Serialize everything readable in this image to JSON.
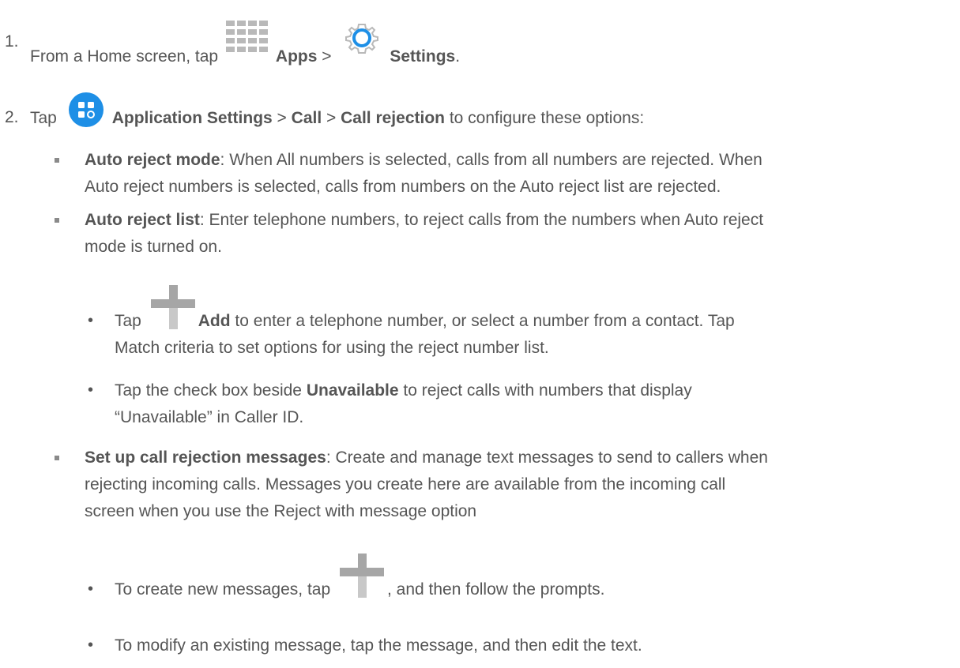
{
  "steps": [
    {
      "number": "1.",
      "pre": "From a Home screen, tap ",
      "apps_label": "Apps",
      "sep": " > ",
      "settings_label": "Settings",
      "end": "."
    },
    {
      "number": "2.",
      "pre": "Tap ",
      "app_settings_label": "Application Settings",
      "sep1": " > ",
      "call_label": "Call",
      "sep2": " > ",
      "call_rejection_label": "Call rejection",
      "post": " to configure these options:"
    }
  ],
  "options": {
    "auto_reject_mode": {
      "title": "Auto reject mode",
      "line1": ": When All numbers is selected, calls from all numbers are rejected. When",
      "line2": "Auto reject numbers is selected, calls from numbers on the Auto reject list are rejected."
    },
    "auto_reject_list": {
      "title": "Auto reject list",
      "line1": ": Enter telephone numbers, to reject calls from the numbers when Auto reject",
      "line2": "mode is turned on.",
      "bullets": [
        {
          "pre": "Tap ",
          "bold": "Add",
          "line1_post": " to enter a telephone number, or select a number from a contact. Tap",
          "line2": "Match criteria to set options for using the reject number list."
        },
        {
          "pre": "Tap the check box beside ",
          "bold": "Unavailable",
          "line1_post": " to reject calls with numbers that display",
          "line2": "“Unavailable” in Caller ID."
        }
      ]
    },
    "call_rejection_messages": {
      "title": "Set up call rejection messages",
      "line1": ": Create and manage text messages to send to callers when",
      "line2": "rejecting incoming calls. Messages you create here are available from the incoming call",
      "line3": "screen when you use the Reject with message option",
      "bullets": [
        {
          "pre": "To create new messages, tap ",
          "post": ", and then follow the prompts."
        },
        {
          "text": "To modify an existing message, tap the message, and then edit the text."
        }
      ]
    }
  },
  "bullet_glyph": "•",
  "icons": [
    "apps-icon",
    "settings-gear-icon",
    "application-settings-icon",
    "plus-icon"
  ],
  "colors": {
    "text": "#555555",
    "icon_gray": "#b9b9b9",
    "accent_blue": "#1e8fe6"
  }
}
